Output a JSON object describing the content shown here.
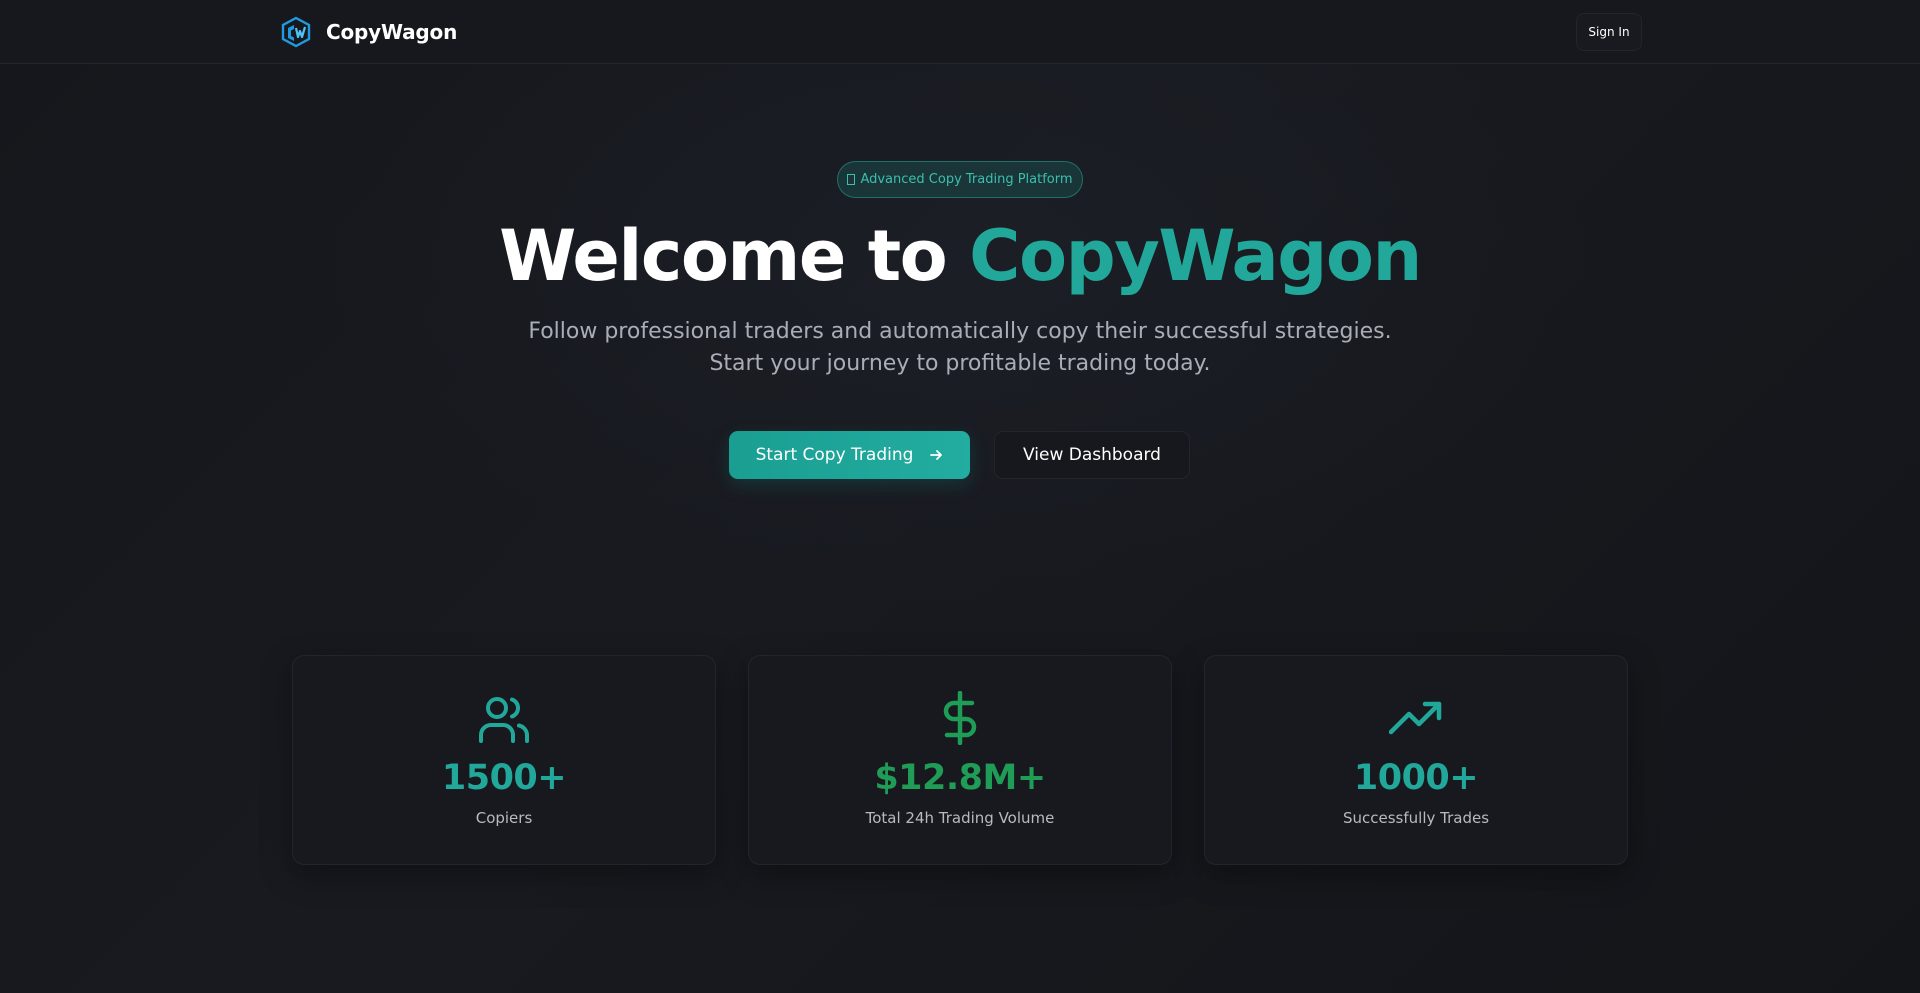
{
  "header": {
    "brand_name": "CopyWagon",
    "signin_label": "Sign In"
  },
  "hero": {
    "badge_text": "Advanced Copy Trading Platform",
    "title_prefix": "Welcome to ",
    "title_accent": "CopyWagon",
    "subtitle": "Follow professional traders and automatically copy their successful strategies. Start your journey to profitable trading today.",
    "primary_cta": "Start Copy Trading",
    "secondary_cta": "View Dashboard"
  },
  "stats": [
    {
      "icon": "users-icon",
      "value": "1500+",
      "label": "Copiers",
      "color": "#22a89a"
    },
    {
      "icon": "dollar-icon",
      "value": "$12.8M+",
      "label": "Total 24h Trading Volume",
      "color": "#1f9d57"
    },
    {
      "icon": "trending-up-icon",
      "value": "1000+",
      "label": "Successfully Trades",
      "color": "#22a89a"
    }
  ],
  "colors": {
    "accent": "#22a89a",
    "accent_green": "#1f9d57",
    "background": "#14161b",
    "logo_blue": "#1e9be0"
  }
}
